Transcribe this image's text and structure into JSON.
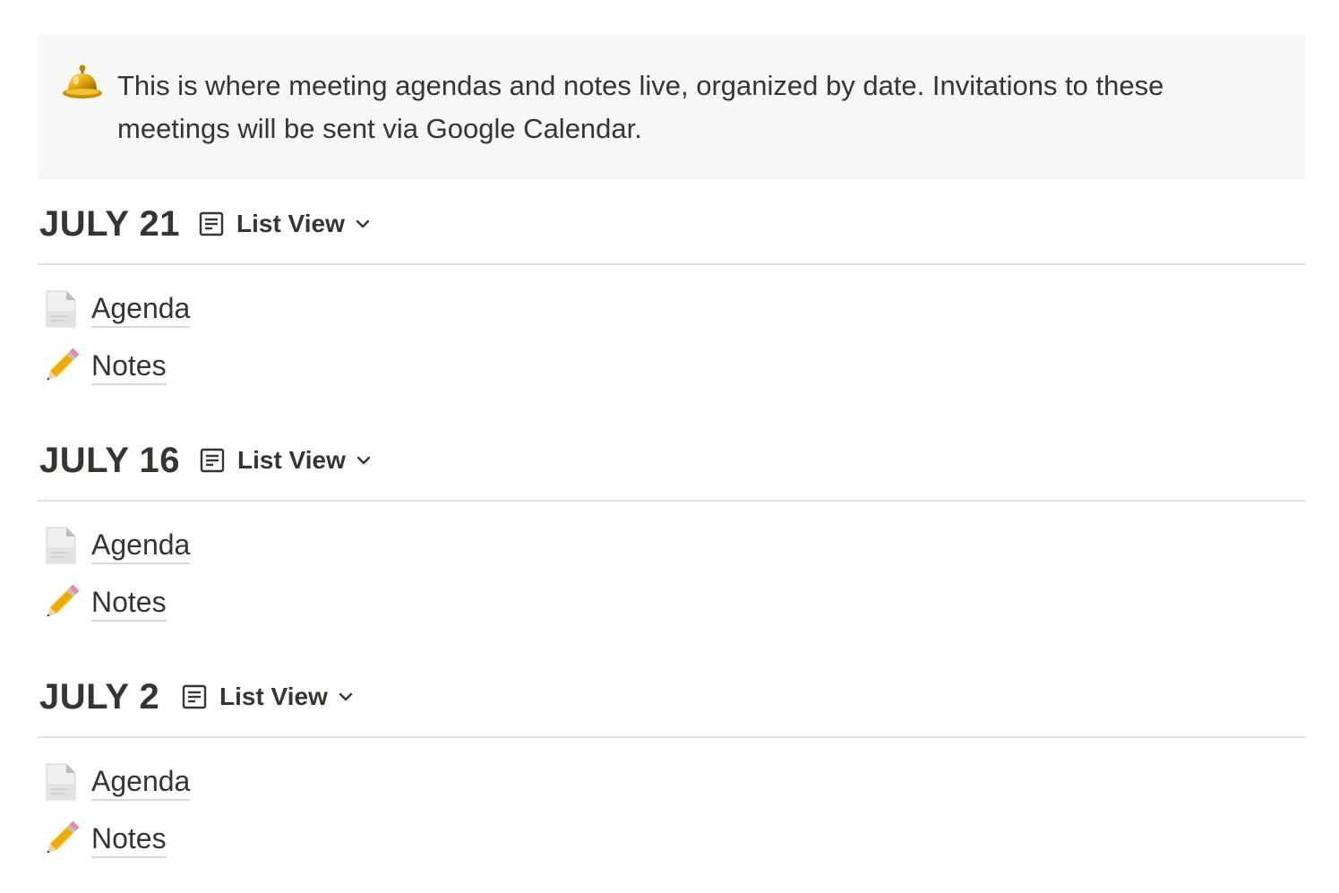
{
  "callout": {
    "icon": "bell-icon",
    "text": "This is where meeting agendas and notes live, organized by date. Invitations to these meetings will be sent via Google Calendar."
  },
  "sections": [
    {
      "date": "JULY 21",
      "view_icon": "list-view-icon",
      "view_label": "List View",
      "items": [
        {
          "icon": "document-icon",
          "label": "Agenda"
        },
        {
          "icon": "pencil-icon",
          "label": "Notes"
        }
      ]
    },
    {
      "date": "JULY 16",
      "view_icon": "list-view-icon",
      "view_label": "List View",
      "items": [
        {
          "icon": "document-icon",
          "label": "Agenda"
        },
        {
          "icon": "pencil-icon",
          "label": "Notes"
        }
      ]
    },
    {
      "date": "JULY 2",
      "view_icon": "list-view-icon",
      "view_label": "List View",
      "items": [
        {
          "icon": "document-icon",
          "label": "Agenda"
        },
        {
          "icon": "pencil-icon",
          "label": "Notes"
        }
      ]
    }
  ],
  "colors": {
    "text": "#37352f",
    "callout_bg": "#f7f7f7",
    "divider": "#dfdfde"
  }
}
